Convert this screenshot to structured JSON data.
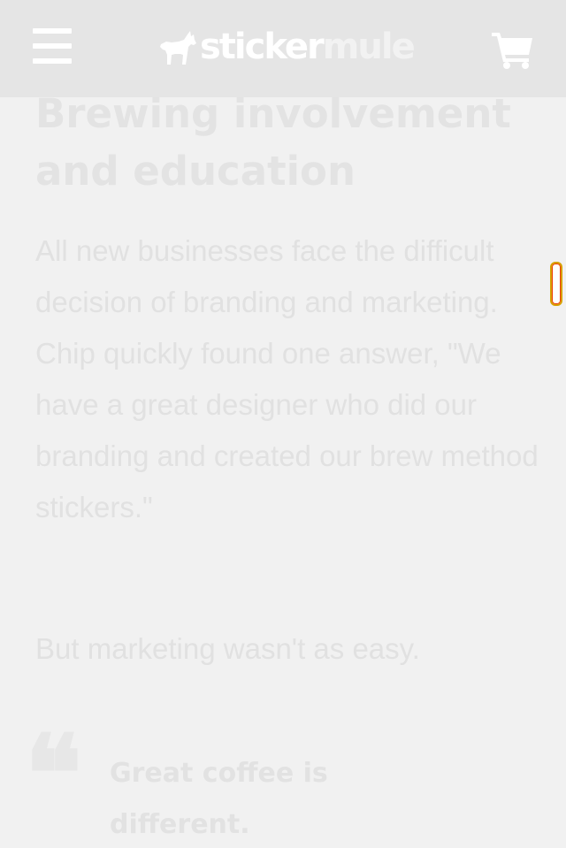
{
  "header": {
    "logo": {
      "part1": "sticker",
      "part2": "mule"
    }
  },
  "article": {
    "heading": "Brewing involvement and education",
    "paragraphs": [
      "All new businesses face the difficult decision of branding and marketing. Chip quickly found one answer, \"We have a great designer who did our branding and created our brew method stickers.\"",
      "But marketing wasn't as easy."
    ],
    "pull_quote": "Great coffee is different."
  },
  "icons": {
    "menu": "hamburger-menu-icon",
    "logo_mark": "mule-icon",
    "cart": "shopping-cart-icon",
    "quote": "quote-mark-icon"
  },
  "colors": {
    "header_bg": "#e5e5e5",
    "page_bg": "#f1f1f1",
    "header_icons": "#ffffff"
  }
}
